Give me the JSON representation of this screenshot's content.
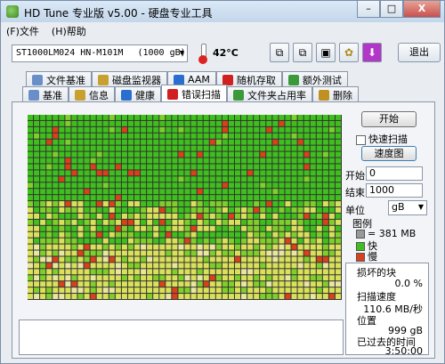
{
  "window": {
    "title": "HD Tune 专业版 v5.00 - 硬盘专业工具",
    "buttons": [
      "–",
      "□",
      "X"
    ]
  },
  "menu": [
    "(F)文件",
    "(H)帮助"
  ],
  "toolbar": {
    "drive": "ST1000LM024 HN-M101M",
    "capacity": "(1000 gB)",
    "temperature": "42°C",
    "exit_label": "退出"
  },
  "tabs_top": [
    {
      "label": "文件基准",
      "icon": "file-benchmark-icon"
    },
    {
      "label": "磁盘监视器",
      "icon": "disk-monitor-icon"
    },
    {
      "label": "AAM",
      "icon": "speaker-icon"
    },
    {
      "label": "随机存取",
      "icon": "random-access-icon"
    },
    {
      "label": "额外测试",
      "icon": "extra-tests-icon"
    }
  ],
  "tabs_bottom": [
    {
      "label": "基准",
      "icon": "benchmark-icon"
    },
    {
      "label": "信息",
      "icon": "info-icon"
    },
    {
      "label": "健康",
      "icon": "health-cross-icon"
    },
    {
      "label": "错误扫描",
      "icon": "error-scan-icon",
      "active": true
    },
    {
      "label": "文件夹占用率",
      "icon": "folder-usage-icon"
    },
    {
      "label": "删除",
      "icon": "delete-icon"
    }
  ],
  "controls": {
    "start_label": "开始",
    "quick_scan_label": "快速扫描",
    "quick_scan_checked": false,
    "speed_map_label": "速度图",
    "start_pos_label": "开始",
    "start_pos_value": "0",
    "end_pos_label": "结束",
    "end_pos_value": "1000",
    "unit_label": "单位",
    "unit_value": "gB"
  },
  "legend": {
    "title": "图例",
    "block": "= 381 MB",
    "ok": "快",
    "bad": "慢"
  },
  "stats": {
    "damaged_label": "损坏的块",
    "damaged_value": "0.0 %",
    "speed_label": "扫描速度",
    "speed_value": "110.6 MB/秒",
    "position_label": "位置",
    "position_value": "999 gB",
    "elapsed_label": "已过去的时间",
    "elapsed_value": "3:50:00"
  },
  "colors": {
    "ok": "#3fbf1e",
    "ok_light": "#7fcf2a",
    "slow": "#d9e05a",
    "bad": "#d9401c",
    "pending": "#e8e6a0"
  }
}
